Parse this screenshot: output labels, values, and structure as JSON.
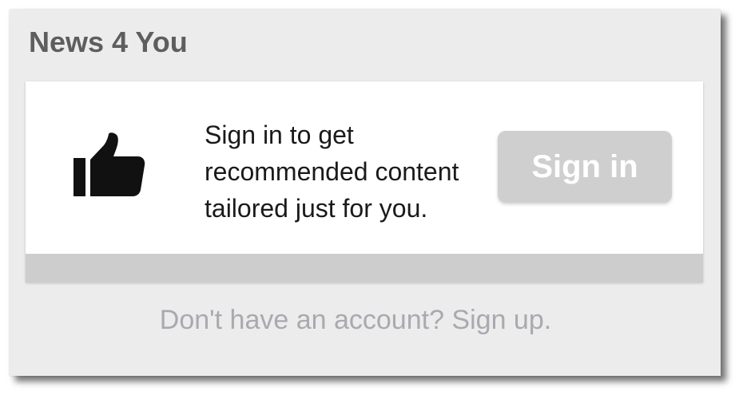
{
  "widget": {
    "title": "News 4 You"
  },
  "card": {
    "icon": "thumbs-up-icon",
    "message_lines": [
      "Sign in to get",
      "recommended content",
      "tailored just for you."
    ],
    "signin_label": "Sign in"
  },
  "footer": {
    "signup_text": "Don't have an account? Sign up."
  },
  "colors": {
    "panel_background": "#ececec",
    "title_text": "#5e5e5e",
    "button_background": "#cfcfcf",
    "button_text": "#ffffff",
    "link_text": "#a9a9b0",
    "card_bar": "#cdcdcd"
  }
}
